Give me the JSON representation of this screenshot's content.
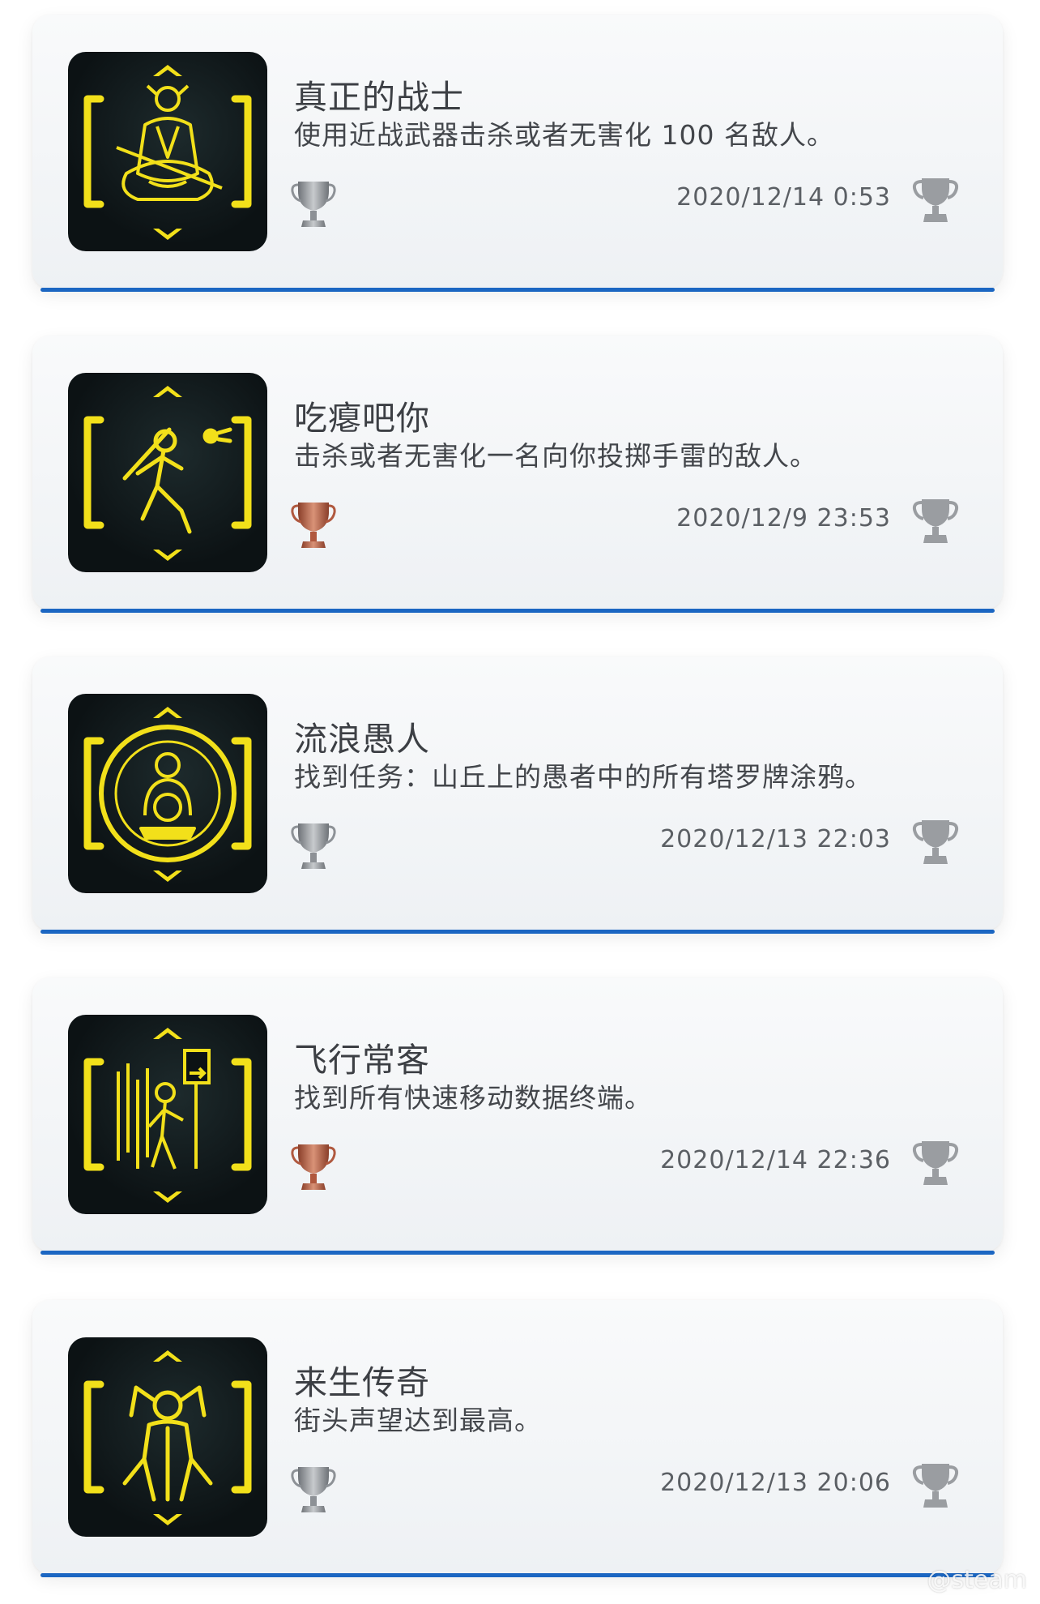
{
  "achievements": [
    {
      "title": "真正的战士",
      "description": "使用近战武器击杀或者无害化 100 名敌人。",
      "date": "2020/12/14  0:53",
      "rarity": "silver",
      "icon": "samurai-meditation-icon"
    },
    {
      "title": "吃瘪吧你",
      "description": "击杀或者无害化一名向你投掷手雷的敌人。",
      "date": "2020/12/9  23:53",
      "rarity": "bronze",
      "icon": "baseball-batter-icon"
    },
    {
      "title": "流浪愚人",
      "description": "找到任务：山丘上的愚者中的所有塔罗牌涂鸦。",
      "date": "2020/12/13  22:03",
      "rarity": "silver",
      "icon": "fool-tarot-icon"
    },
    {
      "title": "飞行常客",
      "description": "找到所有快速移动数据终端。",
      "date": "2020/12/14  22:36",
      "rarity": "bronze",
      "icon": "one-way-traveler-icon"
    },
    {
      "title": "来生传奇",
      "description": "街头声望达到最高。",
      "date": "2020/12/13  20:06",
      "rarity": "silver",
      "icon": "legend-figure-icon"
    }
  ],
  "colors": {
    "accent_line": "#1b66c2",
    "icon_yellow": "#f2e01a",
    "silver": "#8d9196",
    "bronze": "#b0583e",
    "earned_cup": "#9a9da1"
  },
  "watermark": "@steam"
}
